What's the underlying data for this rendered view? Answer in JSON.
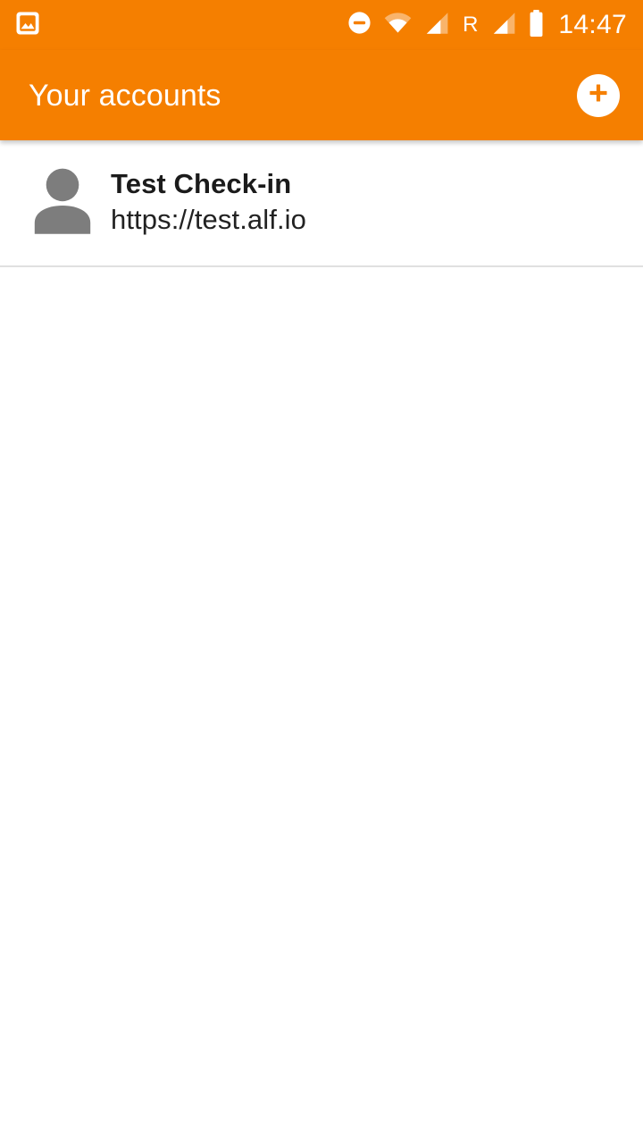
{
  "status_bar": {
    "left_icons": [
      {
        "name": "screenshot-image-icon",
        "glyph": "image"
      }
    ],
    "right_icons": [
      {
        "name": "do-not-disturb-icon",
        "glyph": "minus-circle"
      },
      {
        "name": "wifi-icon",
        "glyph": "wifi"
      },
      {
        "name": "cellular-signal-1-icon",
        "glyph": "signal"
      },
      {
        "name": "roaming-indicator",
        "glyph": "text",
        "label": "R"
      },
      {
        "name": "cellular-signal-2-icon",
        "glyph": "signal"
      },
      {
        "name": "battery-icon",
        "glyph": "battery"
      }
    ],
    "roaming_label": "R",
    "clock": "14:47"
  },
  "toolbar": {
    "title": "Your accounts",
    "add_button_label": "+",
    "background_color": "#F57F00",
    "text_color": "#FFFFFF"
  },
  "accounts": [
    {
      "name": "Test Check-in",
      "url": "https://test.alf.io",
      "avatar_icon": "person-icon"
    }
  ],
  "colors": {
    "accent_orange": "#F57F00",
    "surface_white": "#FFFFFF",
    "divider_gray": "#E0E0E0",
    "avatar_gray": "#7D7D7D",
    "primary_text": "#1B1B1B",
    "secondary_text": "#222222"
  }
}
